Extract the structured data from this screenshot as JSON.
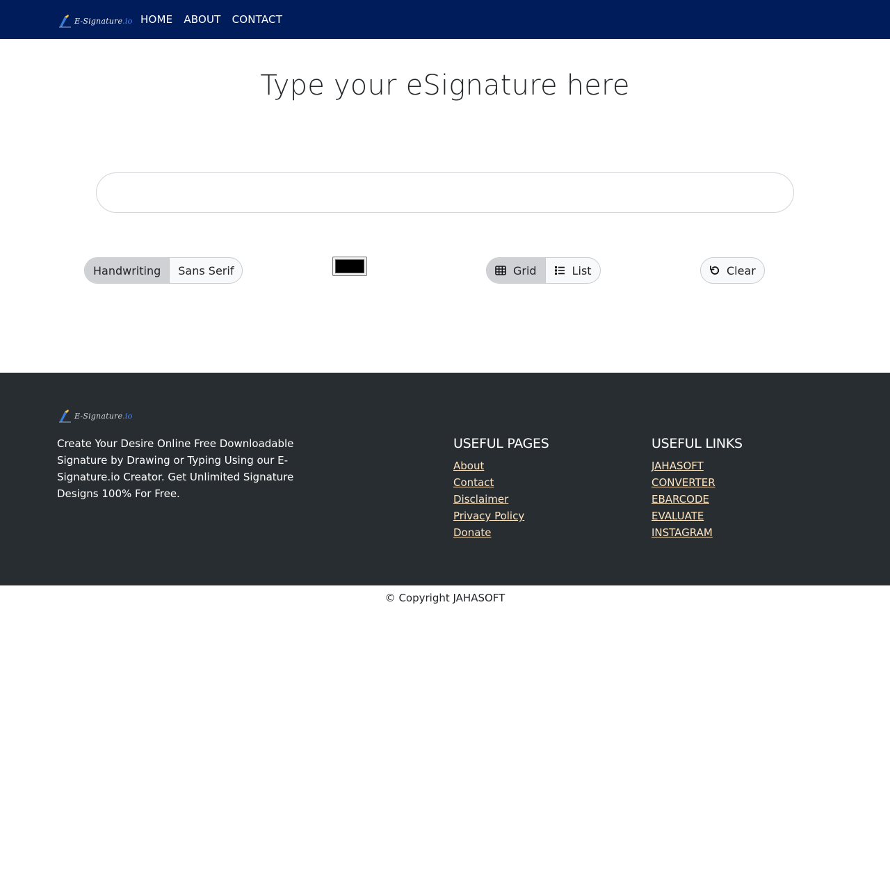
{
  "brand": {
    "name": "E-Signature",
    "tld": ".io"
  },
  "nav": {
    "items": [
      "HOME",
      "ABOUT",
      "CONTACT"
    ]
  },
  "main": {
    "title": "Type your eSignature here",
    "input": {
      "value": "",
      "placeholder": ""
    },
    "font_options": [
      "Handwriting",
      "Sans Serif"
    ],
    "font_selected": "Handwriting",
    "color_value": "#000000",
    "view_options": [
      "Grid",
      "List"
    ],
    "view_selected": "Grid",
    "clear_label": "Clear"
  },
  "footer": {
    "description": "Create Your Desire Online Free Downloadable Signature by Drawing or Typing Using our E-Signature.io Creator. Get Unlimited Signature Designs 100% For Free.",
    "useful_pages": {
      "title": "USEFUL PAGES",
      "items": [
        "About",
        "Contact",
        "Disclaimer",
        "Privacy Policy",
        "Donate"
      ]
    },
    "useful_links": {
      "title": "USEFUL LINKS",
      "items": [
        "JAHASOFT",
        "CONVERTER",
        "EBARCODE",
        "EVALUATE",
        "INSTAGRAM"
      ]
    }
  },
  "copyright": "© Copyright JAHASOFT",
  "colors": {
    "navbar_bg": "#001c5a",
    "footer_bg": "#272d30",
    "footer_link": "#fce3c2",
    "active_segment": "#cfd1d4"
  }
}
